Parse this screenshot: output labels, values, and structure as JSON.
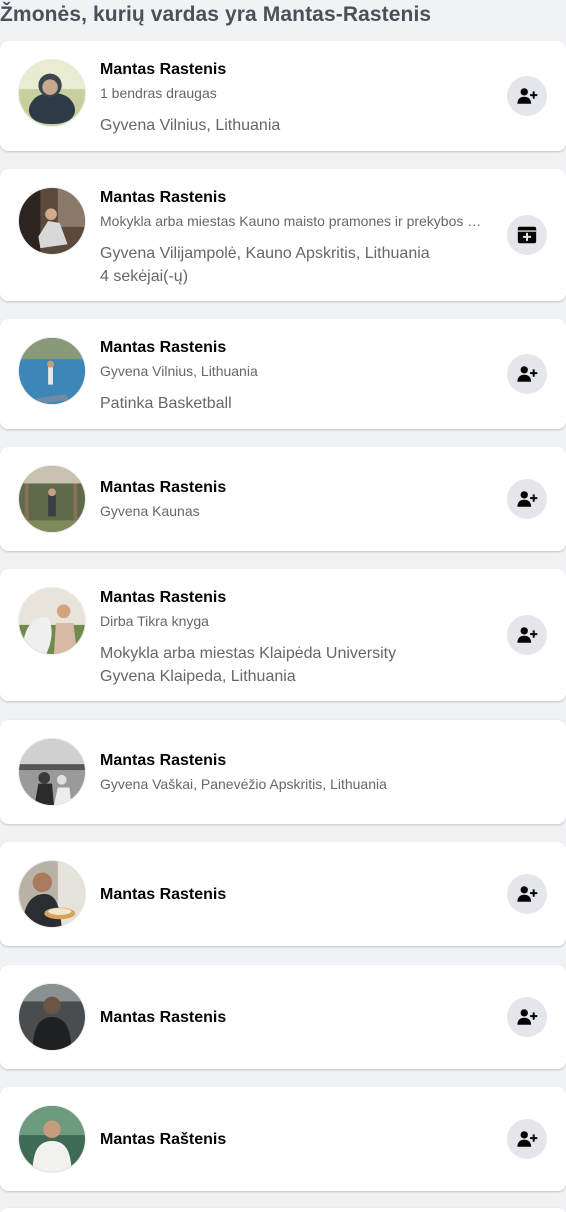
{
  "header": {
    "title": "Žmonės, kurių vardas yra Mantas-Rastenis"
  },
  "results": [
    {
      "name": "Mantas Rastenis",
      "subtitle": "1 bendras draugas",
      "details": [
        "Gyvena Vilnius, Lithuania"
      ],
      "action_icon": "add-friend-icon"
    },
    {
      "name": "Mantas Rastenis",
      "subtitle": "Mokykla arba miestas Kauno maisto pramones ir prekybos mokymo centras",
      "details": [
        "Gyvena Vilijampolė, Kauno Apskritis, Lithuania",
        "4 sekėjai(-ų)"
      ],
      "action_icon": "follow-icon"
    },
    {
      "name": "Mantas Rastenis",
      "subtitle": "Gyvena Vilnius, Lithuania",
      "details": [
        "Patinka Basketball"
      ],
      "action_icon": "add-friend-icon"
    },
    {
      "name": "Mantas Rastenis",
      "subtitle": "Gyvena Kaunas",
      "details": [],
      "action_icon": "add-friend-icon"
    },
    {
      "name": "Mantas Rastenis",
      "subtitle": "Dirba Tikra knyga",
      "details": [
        "Mokykla arba miestas Klaipėda University",
        "Gyvena Klaipeda, Lithuania"
      ],
      "action_icon": "add-friend-icon"
    },
    {
      "name": "Mantas Rastenis",
      "subtitle": "Gyvena Vaškai, Panevėžio Apskritis, Lithuania",
      "details": [],
      "action_icon": null
    },
    {
      "name": "Mantas Rastenis",
      "subtitle": "",
      "details": [],
      "action_icon": "add-friend-icon"
    },
    {
      "name": "Mantas Rastenis",
      "subtitle": "",
      "details": [],
      "action_icon": "add-friend-icon"
    },
    {
      "name": "Mantas Raštenis",
      "subtitle": "",
      "details": [],
      "action_icon": "add-friend-icon"
    }
  ],
  "colors": {
    "background": "#f0f2f5",
    "card": "#ffffff",
    "action_bg": "#e4e6eb",
    "icon": "#050505",
    "secondary_text": "#65676b"
  }
}
